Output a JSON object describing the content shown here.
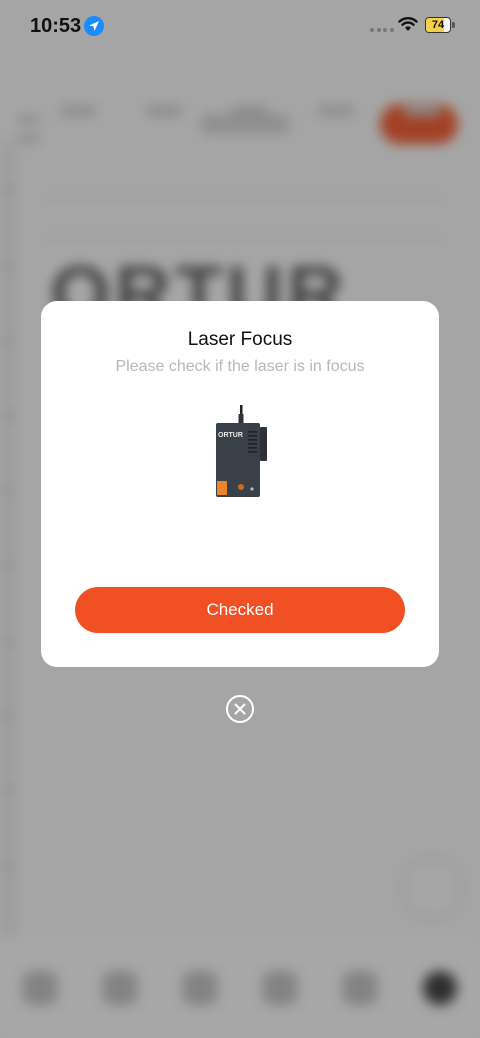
{
  "status_bar": {
    "time": "10:53",
    "battery_level": "74",
    "icons": [
      "location-arrow-icon",
      "signal-dots-icon",
      "wifi-icon",
      "battery-icon"
    ]
  },
  "background": {
    "logo_text": "ORTUR"
  },
  "modal": {
    "title": "Laser Focus",
    "subtitle": "Please check if the laser is in focus",
    "image_label": "ORTUR",
    "confirm_label": "Checked",
    "close_icon": "close-circle-icon"
  },
  "colors": {
    "accent": "#f05023",
    "subtitle": "#b8b8b8"
  }
}
